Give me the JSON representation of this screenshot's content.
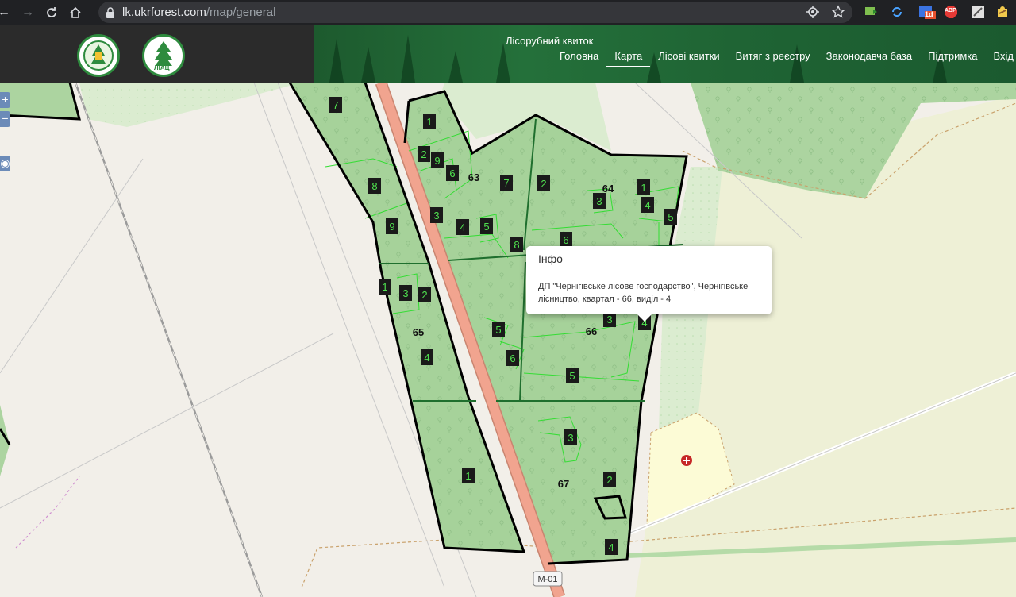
{
  "browser": {
    "url_domain": "lk.ukrforest.com",
    "url_path": "/map/general",
    "extension_badge": "1d",
    "adblock_label": "ABP"
  },
  "header": {
    "site_title": "Лісорубний квиток",
    "logo_right_text": "ЛІАЦ",
    "nav": [
      {
        "label": "Головна",
        "active": false
      },
      {
        "label": "Карта",
        "active": true
      },
      {
        "label": "Лісові квитки",
        "active": false
      },
      {
        "label": "Витяг з реєстру",
        "active": false
      },
      {
        "label": "Законодавча база",
        "active": false
      },
      {
        "label": "Підтримка",
        "active": false
      },
      {
        "label": "Вхід",
        "active": false
      }
    ]
  },
  "map_controls": {
    "zoom_in": "+",
    "zoom_out": "−"
  },
  "map": {
    "quarters": [
      "63",
      "64",
      "65",
      "66",
      "67"
    ],
    "road_label": "M-01",
    "plot_labels": [
      "7",
      "1",
      "2",
      "9",
      "6",
      "7",
      "2",
      "1",
      "3",
      "4",
      "5",
      "8",
      "3",
      "4",
      "5",
      "8",
      "6",
      "9",
      "1",
      "3",
      "2",
      "4",
      "5",
      "3",
      "4",
      "6",
      "5",
      "3",
      "2",
      "1",
      "4"
    ]
  },
  "popup": {
    "title": "Інфо",
    "text": "ДП \"Чернігівське лісове господарство\", Чернігівське лісництво, квартал - 66, виділ - 4"
  },
  "colors": {
    "forest_fill": "#a6d29a",
    "stand_fill": "#9ccd8f",
    "road": "#f1a48f",
    "quarter_border": "#000000",
    "stand_border": "#33dd33",
    "label_bg": "#1a1a1a",
    "label_fg": "#4fe04f",
    "header_forest": "#24703a"
  }
}
